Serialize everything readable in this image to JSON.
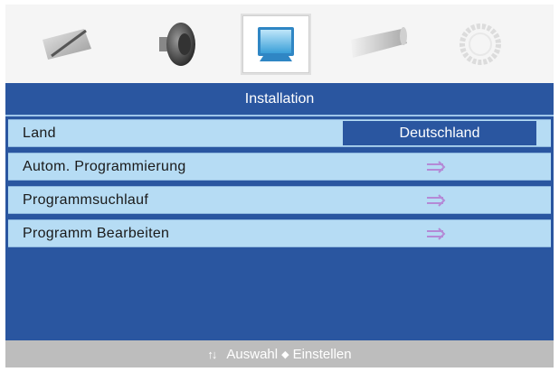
{
  "icon_bar": {
    "icons": [
      {
        "name": "picture-icon",
        "selected": false
      },
      {
        "name": "sound-icon",
        "selected": false
      },
      {
        "name": "installation-icon",
        "selected": true
      },
      {
        "name": "feature-icon",
        "selected": false
      },
      {
        "name": "setup-icon",
        "selected": false
      }
    ]
  },
  "menu": {
    "title": "Installation",
    "items": [
      {
        "label": "Land",
        "value": "Deutschland",
        "type": "select"
      },
      {
        "label": "Autom. Programmierung",
        "type": "submenu-arrow"
      },
      {
        "label": "Programmsuchlauf",
        "type": "submenu-arrow"
      },
      {
        "label": "Programm Bearbeiten",
        "type": "submenu-arrow"
      }
    ]
  },
  "status_bar": {
    "arrows": "↑↓",
    "select_label": "Auswahl",
    "confirm_icon": "◆",
    "confirm_label": "Einstellen"
  },
  "colors": {
    "panel_blue": "#2a56a0",
    "row_light_blue": "#b6dcf4",
    "arrow_purple": "#b48ad6",
    "status_grey": "#bdbdbd"
  }
}
